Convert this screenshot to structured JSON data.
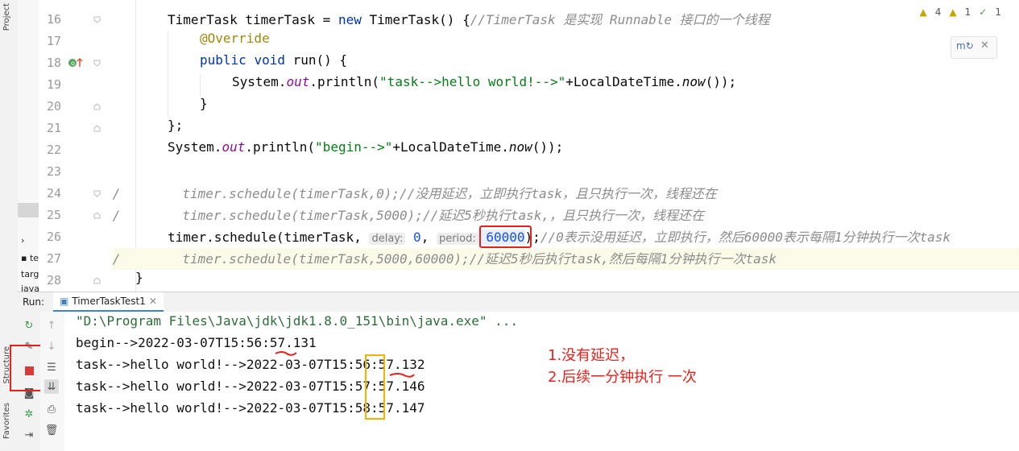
{
  "left_strip": {
    "project_label": "Project",
    "structure_label": "Structure",
    "favorites_label": "Favorites"
  },
  "project_panel": {
    "items": [
      "te",
      "targ",
      "java"
    ]
  },
  "gutter": {
    "line_numbers": [
      "16",
      "17",
      "18",
      "19",
      "20",
      "21",
      "22",
      "23",
      "24",
      "25",
      "26",
      "27",
      "28"
    ]
  },
  "inspections": {
    "warnings": "4",
    "weak_warnings": "1",
    "ok": "1"
  },
  "code": {
    "l16": {
      "type": "TimerTask",
      "var": " timerTask = ",
      "kw_new": "new",
      "ctor": " TimerTask() {",
      "comment": "//TimerTask 是实现 Runnable 接口的一个线程"
    },
    "l17": {
      "annotation": "@Override"
    },
    "l18": {
      "kw_public": "public",
      "kw_void": "void",
      "rest": " run() {"
    },
    "l19": {
      "sys": "System.",
      "out": "out",
      "println": ".println(",
      "str": "\"task-->hello world!-->\"",
      "plus": "+LocalDateTime.",
      "now": "now",
      "end": "());"
    },
    "l20": {
      "text": "}"
    },
    "l21": {
      "text": "};"
    },
    "l22": {
      "sys": "System.",
      "out": "out",
      "println": ".println(",
      "str": "\"begin-->\"",
      "plus": "+LocalDateTime.",
      "now": "now",
      "end": "());"
    },
    "l24": {
      "comment": "//        timer.schedule(timerTask,0);//没用延迟，立即执行task，且只执行一次，线程还在"
    },
    "l25": {
      "comment": "//        timer.schedule(timerTask,5000);//延迟5秒执行task,，且只执行一次，线程还在"
    },
    "l26": {
      "prefix": "timer.schedule(timerTask, ",
      "hint_delay": "delay:",
      "delay_val": " 0",
      "comma": ", ",
      "hint_period": "period:",
      "period_val": " 60000",
      "close": ");",
      "comment": "//0表示没用延迟，立即执行，然后60000表示每隔1分钟执行一次task"
    },
    "l27": {
      "comment": "//        timer.schedule(timerTask,5000,60000);//延迟5秒后执行task,然后每隔1分钟执行一次task"
    },
    "l28": {
      "text": "}"
    }
  },
  "run": {
    "label": "Run:",
    "tab_label": "TimerTaskTest1"
  },
  "console": {
    "cmd": "\"D:\\Program Files\\Java\\jdk\\jdk1.8.0_151\\bin\\java.exe\" ...",
    "lines": [
      "begin-->2022-03-07T15:56:57.131",
      "task-->hello world!-->2022-03-07T15:56:57.132",
      "task-->hello world!-->2022-03-07T15:57:57.146",
      "task-->hello world!-->2022-03-07T15:58:57.147"
    ]
  },
  "annotations": {
    "note1": "1.没有延迟，",
    "note2": "2.后续一分钟执行 一次"
  },
  "colors": {
    "annotation_red": "#e8201b",
    "highlight_orange": "#f0b400",
    "hint_blue": "#1750eb"
  }
}
